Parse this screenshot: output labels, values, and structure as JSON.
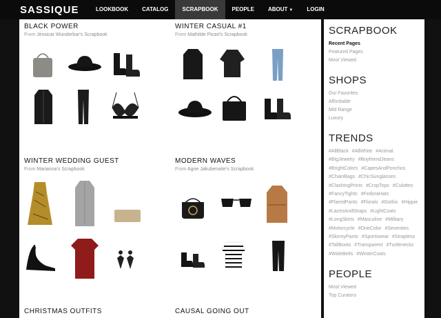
{
  "nav": {
    "logo": "SASSIQUE",
    "items": [
      "LOOKBOOK",
      "CATALOG",
      "SCRAPBOOK",
      "PEOPLE",
      "ABOUT",
      "LOGIN"
    ]
  },
  "cards": [
    {
      "title": "BLACK POWER",
      "from": "From",
      "owner": "Jessicar Wunderbar's Scrapbook"
    },
    {
      "title": "WINTER CASUAL #1",
      "from": "From",
      "owner": "Mathilde Picart's Scrapbook"
    },
    {
      "title": "WINTER WEDDING GUEST",
      "from": "From",
      "owner": "Marianna's Scrapbook"
    },
    {
      "title": "MODERN WAVES",
      "from": "From",
      "owner": "Agne Jakubenaite's Scrapbook"
    },
    {
      "title": "CHRISTMAS OUTFITS",
      "from": "",
      "owner": ""
    },
    {
      "title": "CAUSAL GOING OUT",
      "from": "",
      "owner": ""
    }
  ],
  "sidebar": {
    "scrapbook": {
      "heading": "SCRAPBOOK",
      "links": [
        "Recent Pages",
        "Featured Pages",
        "Most Viewed"
      ]
    },
    "shops": {
      "heading": "SHOPS",
      "links": [
        "Our Favorites",
        "Affordable",
        "Mid Range",
        "Luxury"
      ]
    },
    "trends": {
      "heading": "TRENDS",
      "tags": [
        "#AllBlack",
        "#AllWhite",
        "#Animal",
        "#BigJewelry",
        "#BoyfriendJeans",
        "#BrightColors",
        "#CapesAndPonchos",
        "#ChainBags",
        "#ChicSunglasses",
        "#ClashingPrints",
        "#CropTops",
        "#Culottes",
        "#FancyTights",
        "#FedoraHats",
        "#FlaredPants",
        "#Florals",
        "#Gothic",
        "#Hippie",
        "#LacesAndStraps",
        "#LightCoats",
        "#LongSkirts",
        "#Masculine",
        "#Military",
        "#Motorcycle",
        "#OneColor",
        "#Seventies",
        "#SkinnyPants",
        "#Sportswear",
        "#Strapless",
        "#TallBoots",
        "#Transparent",
        "#Turtlenecks",
        "#WideBelts",
        "#WinterCoats"
      ]
    },
    "people": {
      "heading": "PEOPLE",
      "links": [
        "Most Viewed",
        "Top Curators"
      ]
    }
  },
  "colors": {
    "nav_bg": "#0b0b0b",
    "active_nav": "#3a3a3a",
    "muted_text": "#999999"
  }
}
